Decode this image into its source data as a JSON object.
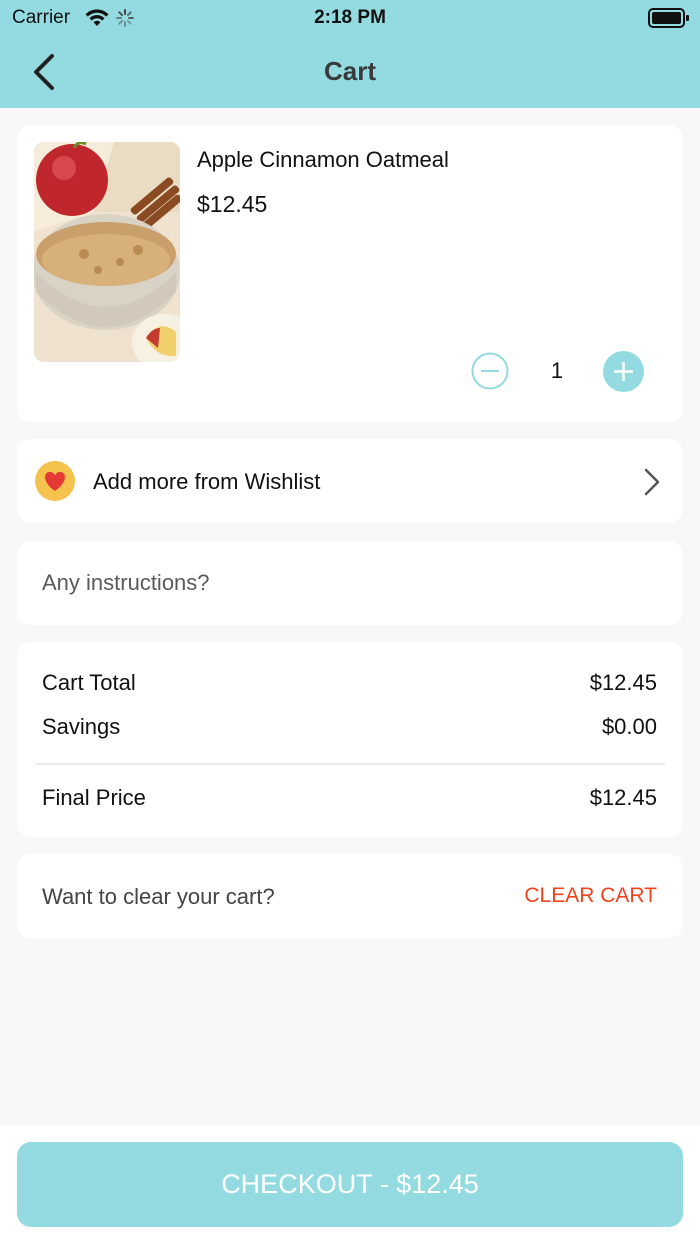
{
  "status_bar": {
    "carrier": "Carrier",
    "time": "2:18 PM"
  },
  "header": {
    "title": "Cart"
  },
  "cart_item": {
    "name": "Apple Cinnamon Oatmeal",
    "price": "$12.45",
    "quantity": "1"
  },
  "wishlist": {
    "label": "Add more from Wishlist"
  },
  "instructions": {
    "placeholder": "Any instructions?"
  },
  "totals": {
    "cart_total_label": "Cart Total",
    "cart_total_value": "$12.45",
    "savings_label": "Savings",
    "savings_value": "$0.00",
    "final_price_label": "Final Price",
    "final_price_value": "$12.45"
  },
  "clear_cart": {
    "question": "Want to clear your cart?",
    "button_label": "CLEAR CART"
  },
  "checkout": {
    "label": "CHECKOUT - $12.45"
  },
  "colors": {
    "accent": "#93dbe1",
    "danger": "#f0441f",
    "background": "#f8f8f8"
  }
}
